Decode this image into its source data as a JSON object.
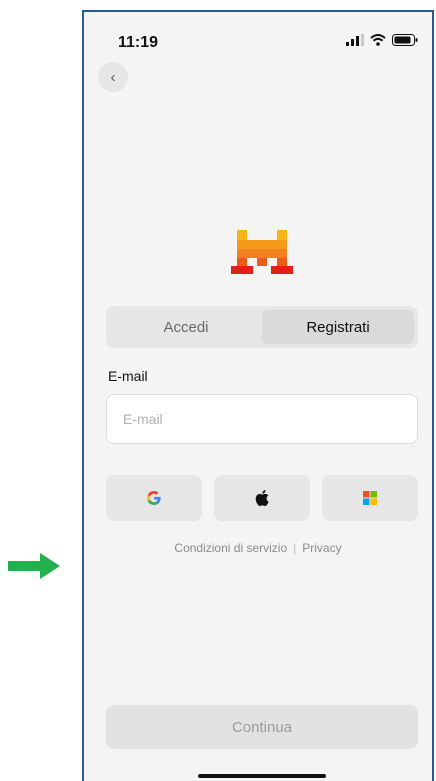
{
  "status_bar": {
    "time": "11:19",
    "icons": [
      "signal-icon",
      "wifi-icon",
      "battery-icon"
    ]
  },
  "back_button": {
    "icon": "chevron-left-icon",
    "glyph": "‹"
  },
  "tabs": [
    {
      "label": "Accedi",
      "active": false
    },
    {
      "label": "Registrati",
      "active": true
    }
  ],
  "email": {
    "label": "E-mail",
    "placeholder": "E-mail",
    "value": ""
  },
  "social_buttons": [
    {
      "name": "google-icon"
    },
    {
      "name": "apple-icon"
    },
    {
      "name": "microsoft-icon"
    }
  ],
  "legal": {
    "terms_label": "Condizioni di servizio",
    "separator": "|",
    "privacy_label": "Privacy"
  },
  "continue_button": {
    "label": "Continua",
    "enabled": false
  },
  "colors": {
    "arrow": "#22b14c",
    "phone_border": "#2a5b8f",
    "background": "#f4f4f4",
    "logo_top": "#f7b418",
    "logo_mid": "#f08020",
    "logo_bottom": "#e22018"
  }
}
